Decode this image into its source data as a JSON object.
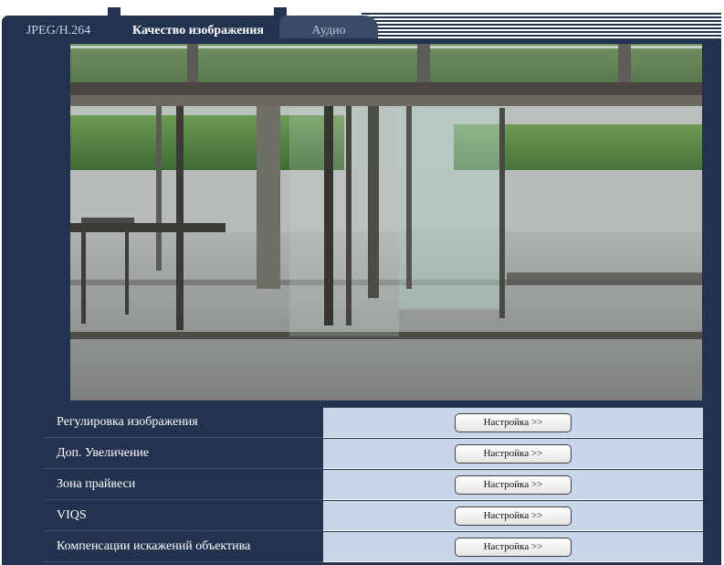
{
  "tabs": [
    {
      "label": "JPEG/H.264"
    },
    {
      "label": "Качество изображения"
    },
    {
      "label": "Аудио"
    }
  ],
  "settings": {
    "rows": [
      {
        "label": "Регулировка изображения",
        "button": "Настройка >>"
      },
      {
        "label": "Доп. Увеличение",
        "button": "Настройка >>"
      },
      {
        "label": "Зона прайвеси",
        "button": "Настройка >>"
      },
      {
        "label": "VIQS",
        "button": "Настройка >>"
      },
      {
        "label": "Компенсации искажений объектива",
        "button": "Настройка >>"
      }
    ]
  },
  "colors": {
    "panel": "#22324f",
    "row_cell": "#c9d6ea",
    "tab_active_text": "#ffffff",
    "tab_inactive_text": "#b6c1d6"
  }
}
